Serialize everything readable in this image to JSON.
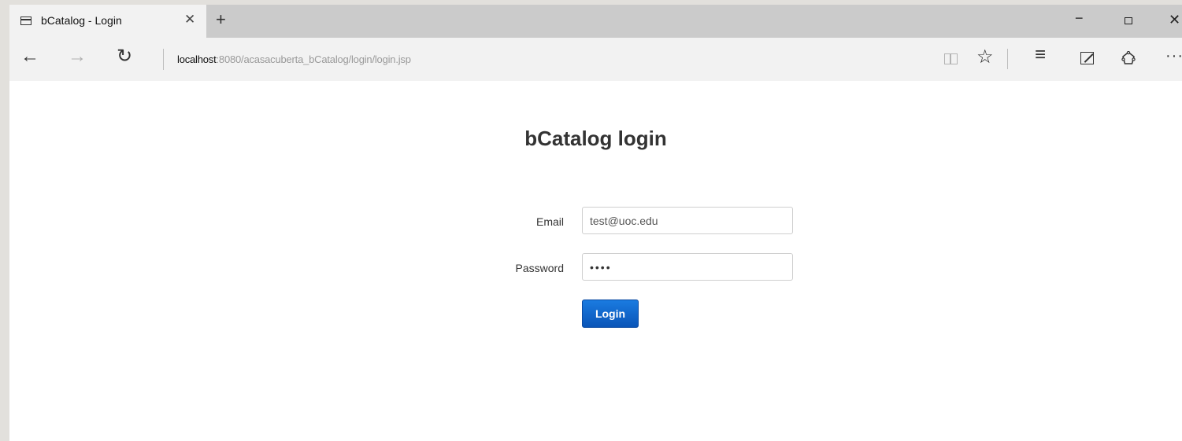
{
  "tab": {
    "title": "bCatalog - Login",
    "close_glyph": "✕",
    "new_tab_glyph": "+"
  },
  "window": {
    "minimize_glyph": "−",
    "close_glyph": "✕"
  },
  "nav": {
    "back_glyph": "←",
    "forward_glyph": "→",
    "refresh_glyph": "↻",
    "url_host": "localhost",
    "url_path": ":8080/acasacuberta_bCatalog/login/login.jsp"
  },
  "toolbar": {
    "favorites_glyph": "☆",
    "hub_glyph": "≡",
    "more_glyph": "···"
  },
  "page": {
    "title": "bCatalog login",
    "email_label": "Email",
    "email_value": "test@uoc.edu",
    "password_label": "Password",
    "password_value": "••••",
    "login_label": "Login"
  }
}
